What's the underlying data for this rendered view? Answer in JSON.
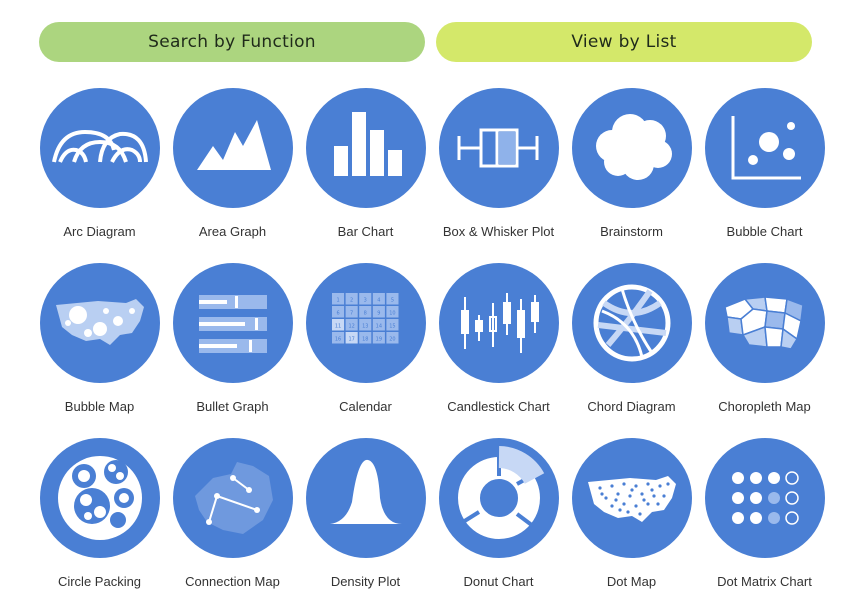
{
  "buttons": {
    "search_by_function": "Search by Function",
    "view_by_list": "View by List"
  },
  "colors": {
    "circle": "#4a7fd4",
    "search_button": "#acd57f",
    "list_button": "#d4e86a"
  },
  "items": [
    {
      "label": "Arc Diagram",
      "icon": "arc-diagram-icon"
    },
    {
      "label": "Area Graph",
      "icon": "area-graph-icon"
    },
    {
      "label": "Bar Chart",
      "icon": "bar-chart-icon"
    },
    {
      "label": "Box & Whisker Plot",
      "icon": "box-whisker-icon"
    },
    {
      "label": "Brainstorm",
      "icon": "brainstorm-icon"
    },
    {
      "label": "Bubble Chart",
      "icon": "bubble-chart-icon"
    },
    {
      "label": "Bubble Map",
      "icon": "bubble-map-icon"
    },
    {
      "label": "Bullet Graph",
      "icon": "bullet-graph-icon"
    },
    {
      "label": "Calendar",
      "icon": "calendar-icon"
    },
    {
      "label": "Candlestick Chart",
      "icon": "candlestick-chart-icon"
    },
    {
      "label": "Chord Diagram",
      "icon": "chord-diagram-icon"
    },
    {
      "label": "Choropleth Map",
      "icon": "choropleth-map-icon"
    },
    {
      "label": "Circle Packing",
      "icon": "circle-packing-icon"
    },
    {
      "label": "Connection Map",
      "icon": "connection-map-icon"
    },
    {
      "label": "Density Plot",
      "icon": "density-plot-icon"
    },
    {
      "label": "Donut Chart",
      "icon": "donut-chart-icon"
    },
    {
      "label": "Dot Map",
      "icon": "dot-map-icon"
    },
    {
      "label": "Dot Matrix Chart",
      "icon": "dot-matrix-chart-icon"
    }
  ],
  "calendar_numbers": [
    "1",
    "2",
    "3",
    "4",
    "5",
    "6",
    "7",
    "8",
    "9",
    "10",
    "11",
    "12",
    "13",
    "14",
    "15",
    "16",
    "17",
    "18",
    "19",
    "20"
  ]
}
